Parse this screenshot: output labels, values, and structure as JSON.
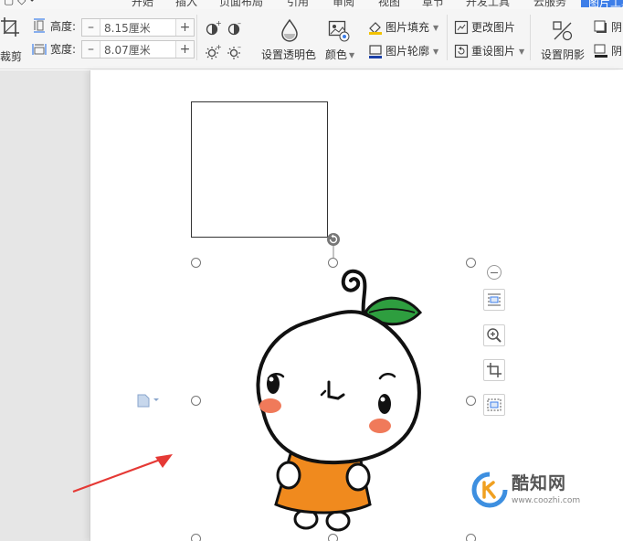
{
  "tabs": [
    "开始",
    "插入",
    "页面布局",
    "引用",
    "审阅",
    "视图",
    "章节",
    "开发工具",
    "云服务",
    "图片工具"
  ],
  "active_tab_index": 9,
  "toolbar": {
    "crop_label": "裁剪",
    "height_label": "高度:",
    "height_value": "8.15厘米",
    "width_label": "宽度:",
    "width_value": "8.07厘米",
    "minus_glyph": "–",
    "plus_glyph": "+",
    "transparent_label": "设置透明色",
    "color_label": "颜色",
    "fill_label": "图片填充",
    "outline_label": "图片轮廓",
    "change_label": "更改图片",
    "reset_label": "重设图片",
    "shadow_label": "设置阴影",
    "shadow_right_1": "阴",
    "shadow_right_2": "阴"
  },
  "watermark": {
    "main": "酷知网",
    "url": "www.coozhi.com"
  },
  "colors": {
    "accent": "#3d7ee8",
    "arrow": "#e53935",
    "leaf": "#2e9e3f",
    "orange": "#f08a1e",
    "blush": "#f07a5a"
  }
}
